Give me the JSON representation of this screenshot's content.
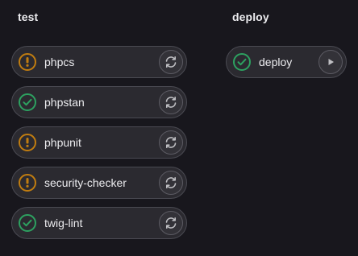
{
  "stages": [
    {
      "title": "test",
      "jobs": [
        {
          "name": "phpcs",
          "status": "warning",
          "status_icon": "warning-icon",
          "action_icon": "retry-icon"
        },
        {
          "name": "phpstan",
          "status": "success",
          "status_icon": "check-icon",
          "action_icon": "retry-icon"
        },
        {
          "name": "phpunit",
          "status": "warning",
          "status_icon": "warning-icon",
          "action_icon": "retry-icon"
        },
        {
          "name": "security-checker",
          "status": "warning",
          "status_icon": "warning-icon",
          "action_icon": "retry-icon"
        },
        {
          "name": "twig-lint",
          "status": "success",
          "status_icon": "check-icon",
          "action_icon": "retry-icon"
        }
      ]
    },
    {
      "title": "deploy",
      "jobs": [
        {
          "name": "deploy",
          "status": "success",
          "status_icon": "check-icon",
          "action_icon": "play-icon"
        }
      ]
    }
  ],
  "colors": {
    "background": "#18171d",
    "warning": "#c17d10",
    "success": "#2da160",
    "job_bg": "#2b2a30",
    "job_border": "#4a4a52"
  }
}
